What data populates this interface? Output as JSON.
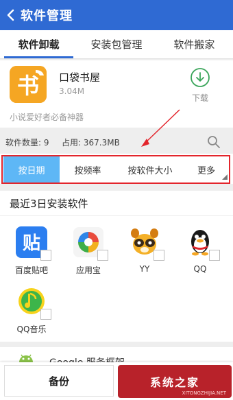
{
  "titlebar": {
    "title": "软件管理",
    "back_icon": "chevron-left-icon"
  },
  "tabs": [
    {
      "label": "软件卸载",
      "active": true
    },
    {
      "label": "安装包管理",
      "active": false
    },
    {
      "label": "软件搬家",
      "active": false
    }
  ],
  "featured_app": {
    "name": "口袋书屋",
    "size": "3.04M",
    "download_label": "下载",
    "slogan": "小说爱好者必备神器",
    "icon_glyph": "书",
    "icon_color": "#f5a623"
  },
  "stats": {
    "count": "软件数量: 9",
    "usage": "占用: 367.3MB"
  },
  "sort_options": [
    {
      "label": "按日期",
      "active": true
    },
    {
      "label": "按频率",
      "active": false
    },
    {
      "label": "按软件大小",
      "active": false
    },
    {
      "label": "更多",
      "active": false
    }
  ],
  "recent": {
    "title": "最近3日安装软件",
    "apps": [
      {
        "label": "百度贴吧",
        "glyph": "贴"
      },
      {
        "label": "应用宝",
        "glyph": ""
      },
      {
        "label": "YY",
        "glyph": ""
      },
      {
        "label": "QQ",
        "glyph": ""
      },
      {
        "label": "QQ音乐",
        "glyph": ""
      }
    ]
  },
  "partial_row": {
    "name": "Google 服务框架"
  },
  "bottom": {
    "backup_label": "备份",
    "watermark_cn": "系统之家",
    "watermark_en": "XITONGZHIJIA.NET"
  },
  "colors": {
    "header": "#2f6ad3",
    "active_sort": "#5eb7f6",
    "highlight": "#e3252c"
  }
}
